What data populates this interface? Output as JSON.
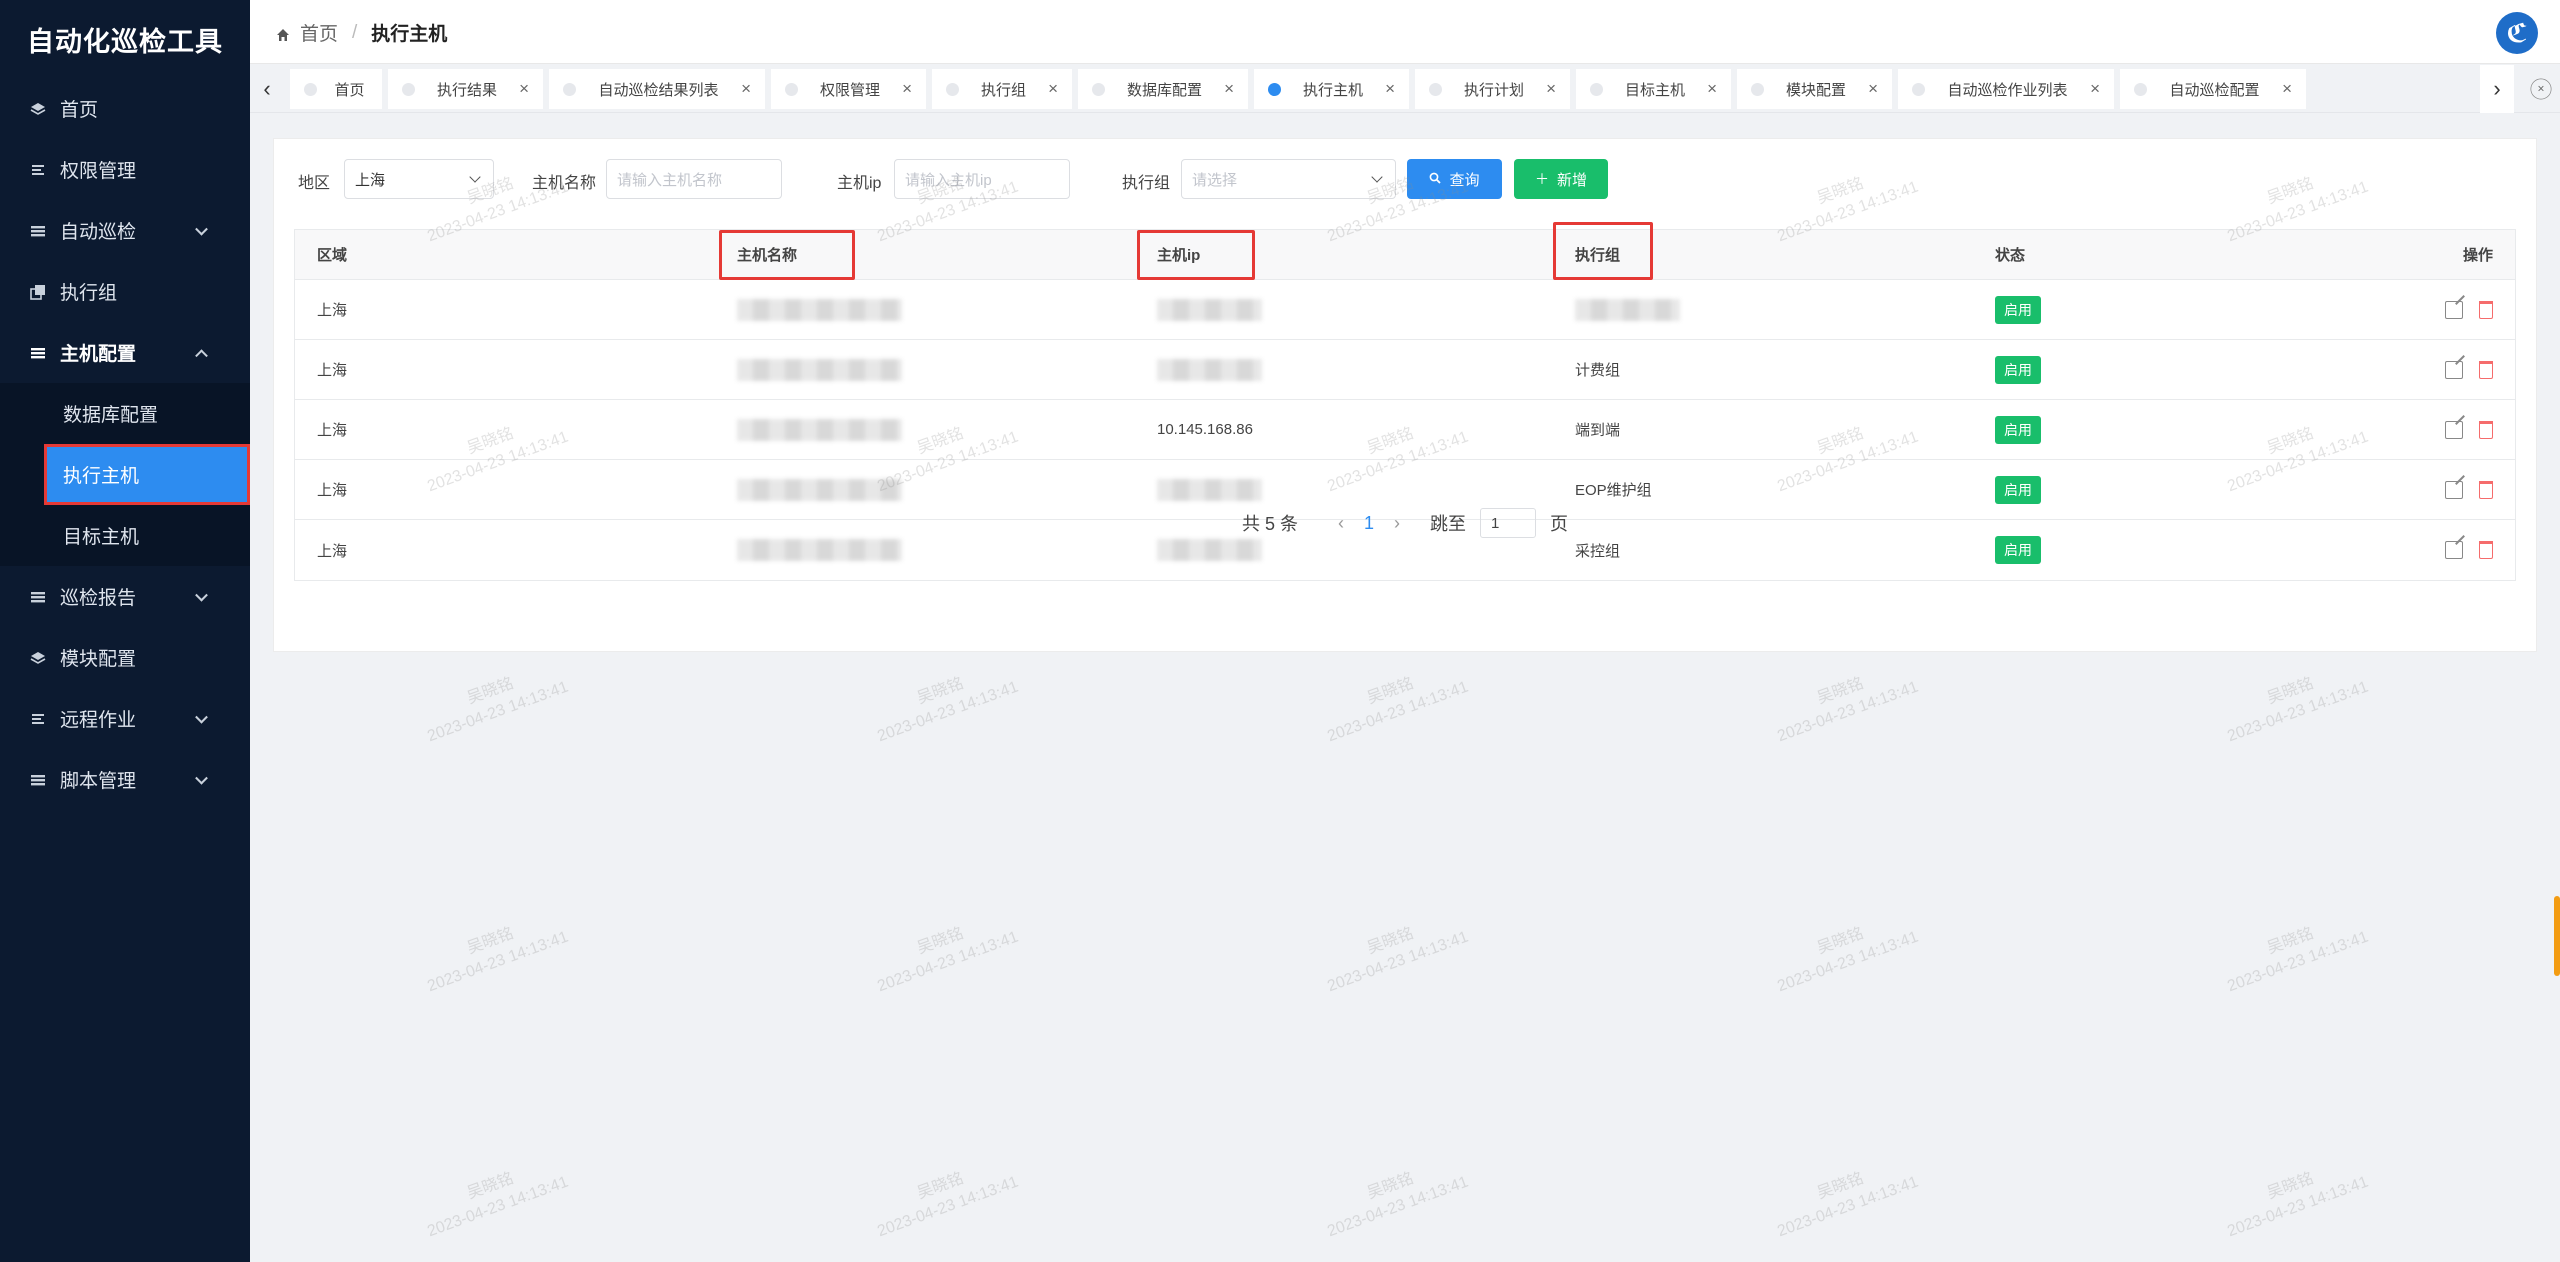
{
  "app": {
    "title": "自动化巡检工具"
  },
  "sidebar": {
    "items": [
      {
        "label": "首页",
        "icon": "layers-icon"
      },
      {
        "label": "权限管理",
        "icon": "list-icon"
      },
      {
        "label": "自动巡检",
        "icon": "menu-icon",
        "expandable": true
      },
      {
        "label": "执行组",
        "icon": "copy-icon"
      },
      {
        "label": "主机配置",
        "icon": "menu-icon",
        "expandable": true,
        "expanded": true
      },
      {
        "label": "巡检报告",
        "icon": "menu-icon",
        "expandable": true
      },
      {
        "label": "模块配置",
        "icon": "layers-icon"
      },
      {
        "label": "远程作业",
        "icon": "list-icon",
        "expandable": true
      },
      {
        "label": "脚本管理",
        "icon": "menu-icon",
        "expandable": true
      }
    ],
    "host_config_children": [
      {
        "label": "数据库配置"
      },
      {
        "label": "执行主机",
        "active": true
      },
      {
        "label": "目标主机"
      }
    ]
  },
  "header": {
    "breadcrumb_home": "首页",
    "breadcrumb_sep": "/",
    "breadcrumb_current": "执行主机",
    "logo_glyph": "ℭ"
  },
  "tabs": [
    {
      "label": "首页",
      "closable": false
    },
    {
      "label": "执行结果",
      "closable": true
    },
    {
      "label": "自动巡检结果列表",
      "closable": true
    },
    {
      "label": "权限管理",
      "closable": true
    },
    {
      "label": "执行组",
      "closable": true
    },
    {
      "label": "数据库配置",
      "closable": true
    },
    {
      "label": "执行主机",
      "closable": true,
      "active": true
    },
    {
      "label": "执行计划",
      "closable": true
    },
    {
      "label": "目标主机",
      "closable": true
    },
    {
      "label": "模块配置",
      "closable": true
    },
    {
      "label": "自动巡检作业列表",
      "closable": true
    },
    {
      "label": "自动巡检配置",
      "closable": true
    }
  ],
  "filter": {
    "region_label": "地区",
    "region_value": "上海",
    "hostname_label": "主机名称",
    "hostname_placeholder": "请输入主机名称",
    "hostip_label": "主机ip",
    "hostip_placeholder": "请输入主机ip",
    "group_label": "执行组",
    "group_placeholder": "请选择",
    "search_button": "查询",
    "add_button": "新增"
  },
  "table": {
    "columns": [
      "区域",
      "主机名称",
      "主机ip",
      "执行组",
      "状态",
      "操作"
    ],
    "rows": [
      {
        "region": "上海",
        "hostname": "",
        "ip": "",
        "group": "",
        "status": "启用"
      },
      {
        "region": "上海",
        "hostname": "",
        "ip": "",
        "group": "计费组",
        "status": "启用"
      },
      {
        "region": "上海",
        "hostname": "",
        "ip": "10.145.168.86",
        "group": "端到端",
        "status": "启用"
      },
      {
        "region": "上海",
        "hostname": "",
        "ip": "",
        "group": "EOP维护组",
        "status": "启用"
      },
      {
        "region": "上海",
        "hostname": "",
        "ip": "",
        "group": "采控组",
        "status": "启用"
      }
    ]
  },
  "pagination": {
    "total": "共 5 条",
    "current_page": "1",
    "jump_label": "跳至",
    "jump_value": "1",
    "page_suffix": "页"
  },
  "watermark": {
    "name": "吴晓铭",
    "time": "2023-04-23 14:13:41"
  },
  "colors": {
    "sidebar_bg": "#0c1a30",
    "primary": "#2d8cf0",
    "success": "#19be6b",
    "highlight": "#e53935"
  }
}
